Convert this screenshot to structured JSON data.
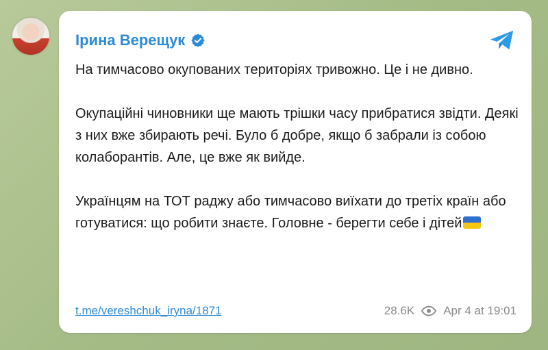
{
  "post": {
    "author": "Ірина Верещук",
    "paragraphs": [
      "На тимчасово окупованих територіях тривожно. Це і не дивно.",
      "Окупаційні чиновники ще мають трішки часу прибратися звідти. Деякі з них вже збирають речі. Було б добре, якщо б забрали із собою колаборантів. Але, це вже як вийде.",
      "Українцям на ТОТ раджу або тимчасово виїхати до третіх країн або готуватися: що робити знаєте. Головне - берегти себе і дітей"
    ],
    "link": "t.me/vereshchuk_iryna/1871",
    "views": "28.6K",
    "date": "Apr 4 at 19:01"
  },
  "icons": {
    "verified": "verified-check-icon",
    "telegram": "telegram-plane-icon",
    "views": "eye-icon",
    "flag": "ukraine-flag-emoji"
  },
  "colors": {
    "accent": "#2d8bd6",
    "background": "#a9bf8c",
    "card": "#ffffff",
    "meta": "#8a8a8a"
  }
}
